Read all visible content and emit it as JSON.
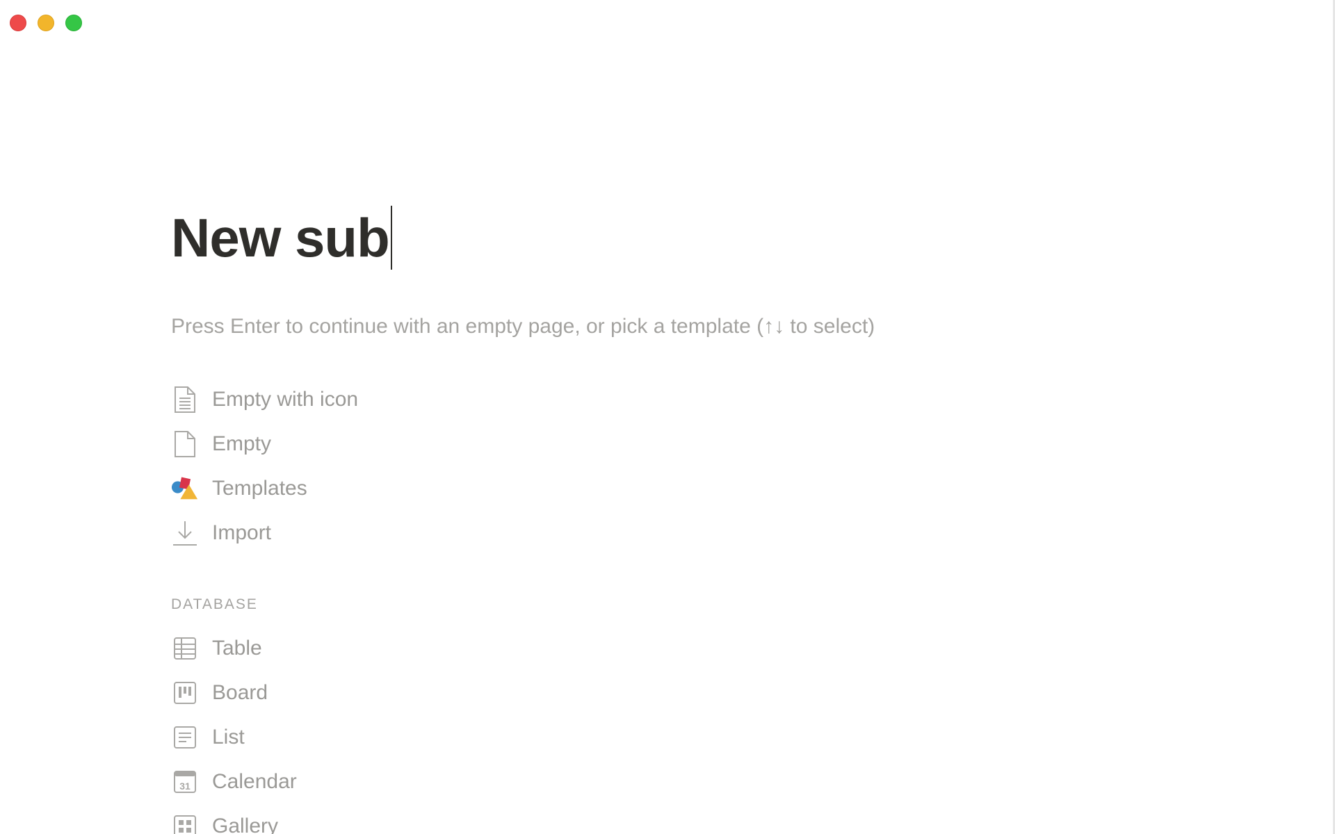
{
  "window": {
    "controls": {
      "close": "close-window",
      "minimize": "minimize-window",
      "maximize": "maximize-window"
    },
    "colors": {
      "close": "#ee4a4a",
      "minimize": "#f2b52b",
      "maximize": "#35c646"
    }
  },
  "page": {
    "title": "New sub",
    "hint": "Press Enter to continue with an empty page, or pick a template (↑↓ to select)"
  },
  "templates": [
    {
      "label": "Empty with icon",
      "icon": "document-lines-icon"
    },
    {
      "label": "Empty",
      "icon": "document-icon"
    },
    {
      "label": "Templates",
      "icon": "shapes-icon"
    },
    {
      "label": "Import",
      "icon": "import-arrow-icon"
    }
  ],
  "database": {
    "section_label": "DATABASE",
    "items": [
      {
        "label": "Table",
        "icon": "table-icon"
      },
      {
        "label": "Board",
        "icon": "board-icon"
      },
      {
        "label": "List",
        "icon": "list-icon"
      },
      {
        "label": "Calendar",
        "icon": "calendar-icon",
        "icon_text": "31"
      },
      {
        "label": "Gallery",
        "icon": "gallery-icon"
      }
    ]
  },
  "colors": {
    "title": "#2f2e2b",
    "muted_text": "#9a9996",
    "icon_stroke": "#a9a8a5"
  }
}
